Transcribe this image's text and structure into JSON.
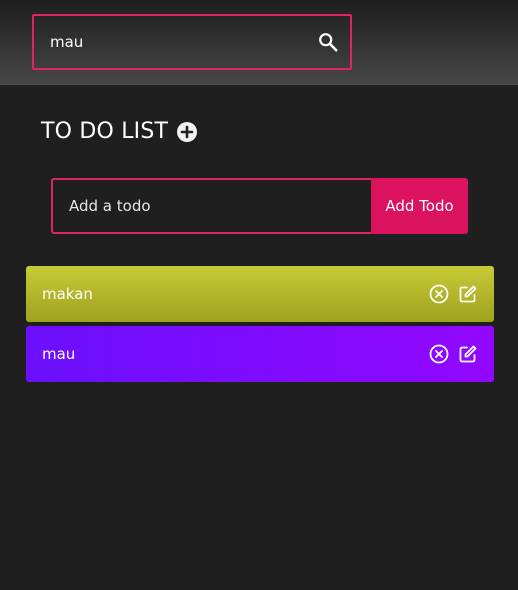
{
  "search": {
    "value": "mau",
    "icon": "search-icon"
  },
  "header": {
    "title": "TO DO LIST",
    "add_icon": "plus-circle-icon"
  },
  "form": {
    "input_placeholder": "Add a todo",
    "add_button_label": "Add Todo"
  },
  "todos": [
    {
      "text": "makan",
      "delete_icon": "close-circle-icon",
      "edit_icon": "edit-icon",
      "color": "#b8bb2e"
    },
    {
      "text": "mau",
      "delete_icon": "close-circle-icon",
      "edit_icon": "edit-icon",
      "color": "#7f0bff"
    }
  ],
  "colors": {
    "accent": "#e0245e",
    "button": "#db135e",
    "background": "#1f1f1f"
  }
}
